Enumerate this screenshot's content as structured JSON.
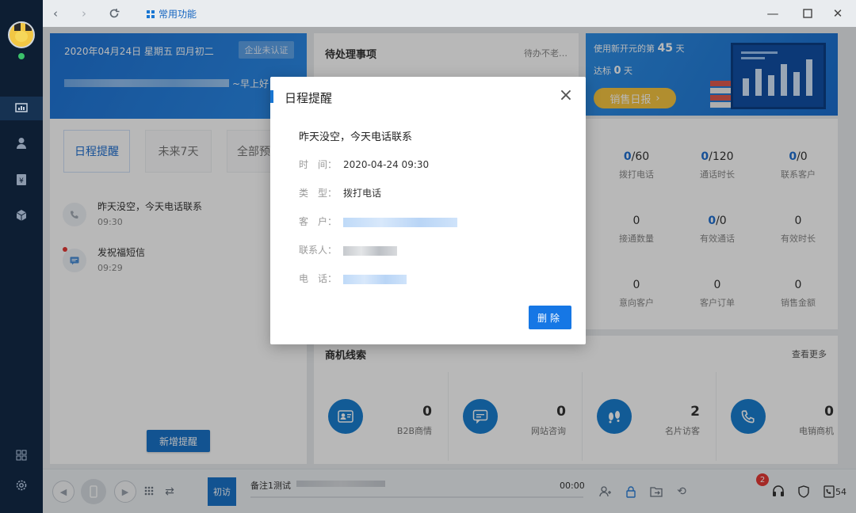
{
  "topbar": {
    "favorites_label": "常用功能"
  },
  "welcome": {
    "date": "2020年04月24日 星期五 四月初二",
    "cert_label": "企业未认证",
    "greeting": "~早上好！"
  },
  "schedule_tabs": [
    "日程提醒",
    "未来7天",
    "全部预"
  ],
  "schedule_items": [
    {
      "title": "昨天没空，今天电话联系",
      "time": "09:30"
    },
    {
      "title": "发祝福短信",
      "time": "09:29"
    }
  ],
  "add_reminder_label": "新增提醒",
  "todo": {
    "title": "待处理事项",
    "right": "待办不老…"
  },
  "banner": {
    "line1_prefix": "使用新开元的第",
    "days": "45",
    "line1_suffix": "天",
    "line2_prefix": "达标",
    "target": "0",
    "line2_suffix": "天",
    "report_label": "销售日报"
  },
  "stats": [
    {
      "value_strong": "0",
      "value_rest": "/60",
      "label": "拨打电话"
    },
    {
      "value_strong": "0",
      "value_rest": "/120",
      "label": "通话时长"
    },
    {
      "value_strong": "0",
      "value_rest": "/0",
      "label": "联系客户"
    },
    {
      "value_strong": "",
      "value_rest": "0",
      "label": "接通数量"
    },
    {
      "value_strong": "0",
      "value_rest": "/0",
      "label": "有效通话"
    },
    {
      "value_strong": "",
      "value_rest": "0",
      "label": "有效时长"
    },
    {
      "value_strong": "",
      "value_rest": "0",
      "label": "意向客户"
    },
    {
      "value_strong": "",
      "value_rest": "0",
      "label": "客户订单"
    },
    {
      "value_strong": "",
      "value_rest": "0",
      "label": "销售金额"
    }
  ],
  "leads": {
    "title": "商机线索",
    "more": "查看更多",
    "items": [
      {
        "label": "B2B商情",
        "count": "0",
        "icon": "user-card-icon"
      },
      {
        "label": "网站咨询",
        "count": "0",
        "icon": "chat-icon"
      },
      {
        "label": "名片访客",
        "count": "2",
        "icon": "footprint-icon"
      },
      {
        "label": "电销商机",
        "count": "0",
        "icon": "phone-icon"
      }
    ]
  },
  "bottom": {
    "tag": "初访",
    "note": "备注1测试",
    "time": "00:00",
    "badge": "2",
    "count": "54"
  },
  "modal": {
    "title": "日程提醒",
    "subject": "昨天没空，今天电话联系",
    "time_label": "时　间：",
    "time_value": "2020-04-24 09:30",
    "type_label": "类　型：",
    "type_value": "拨打电话",
    "customer_label": "客　户：",
    "contact_label": "联系人：",
    "phone_label": "电　话：",
    "delete_label": "删除"
  }
}
